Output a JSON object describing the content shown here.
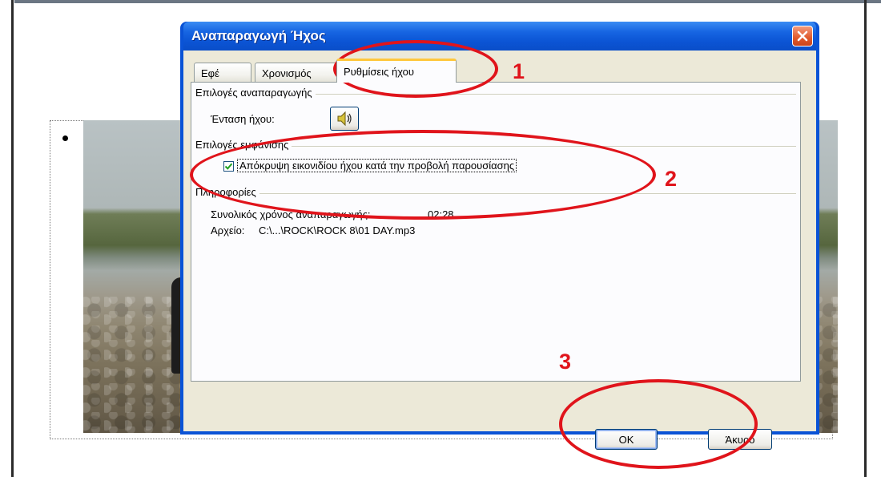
{
  "dialog": {
    "title": "Αναπαραγωγή Ήχος",
    "close_icon": "close-icon"
  },
  "tabs": [
    {
      "label": "Εφέ",
      "active": false
    },
    {
      "label": "Χρονισμός",
      "active": false
    },
    {
      "label": "Ρυθμίσεις ήχου",
      "active": true
    }
  ],
  "playback_options": {
    "group_label": "Επιλογές αναπαραγωγής",
    "volume_label": "Ένταση ήχου:",
    "volume_icon": "speaker-icon"
  },
  "display_options": {
    "group_label": "Επιλογές εμφάνισης",
    "hide_icon_checkbox": {
      "label": "Απόκρυψη εικονιδίου ήχου κατά την προβολή παρουσίασης",
      "checked": true
    }
  },
  "information": {
    "group_label": "Πληροφορίες",
    "total_time_label": "Συνολικός χρόνος αναπαραγωγής:",
    "total_time_value": "02:28",
    "file_label": "Αρχείο:",
    "file_value": "C:\\...\\ROCK\\ROCK 8\\01 DAY.mp3"
  },
  "buttons": {
    "ok": "OK",
    "cancel": "Άκυρο"
  },
  "annotations": {
    "marker_1": "1",
    "marker_2": "2",
    "marker_3": "3",
    "color": "#e0141b"
  },
  "colors": {
    "titlebar": "#0b54d4",
    "dialog_face": "#ece9d8",
    "active_tab_highlight": "#ffc73c"
  }
}
